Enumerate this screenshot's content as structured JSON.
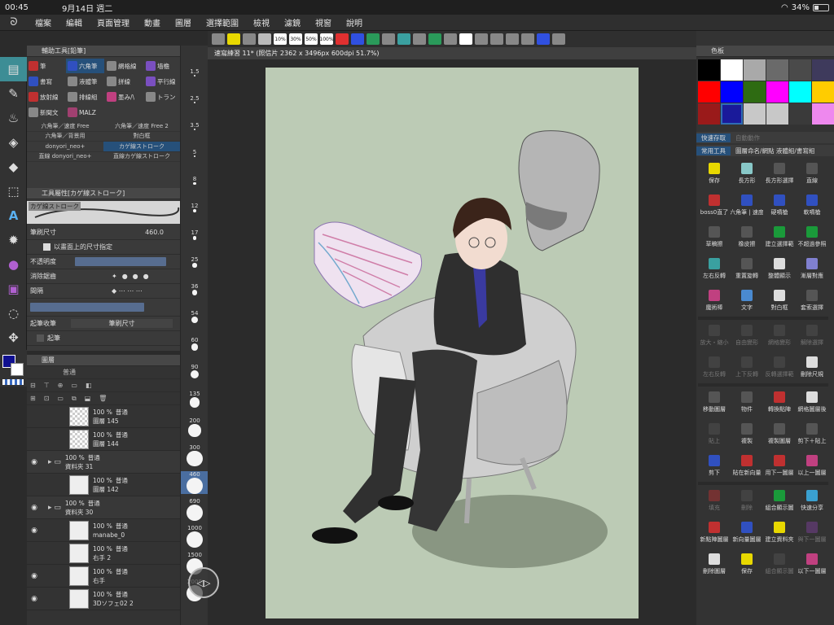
{
  "status": {
    "time": "00:45",
    "date": "9月14日 週二",
    "battery": "34%",
    "battery_level": 0.34
  },
  "menu": [
    "檔案",
    "編輯",
    "頁面管理",
    "動畫",
    "圖層",
    "選擇範圍",
    "檢視",
    "濾鏡",
    "視窗",
    "說明"
  ],
  "left_tools": [
    "select-tool-icon",
    "pen-tool-icon",
    "brush-tool-icon",
    "eraser-tool-icon",
    "fill-tool-icon",
    "selection-tool-icon",
    "text-tool-icon",
    "effect-tool-icon",
    "object-tool-icon",
    "ruler-tool-icon",
    "lasso-tool-icon",
    "move-tool-icon",
    "bucket-tool-icon"
  ],
  "subtool": {
    "title": "輔助工具[鉛筆]",
    "items": [
      {
        "label": "筆",
        "color": "#c03030"
      },
      {
        "label": "六角筆",
        "color": "#3050c0",
        "selected": true
      },
      {
        "label": "網格線",
        "color": "#888888"
      },
      {
        "label": "墙檐",
        "color": "#7a4fc0"
      },
      {
        "label": "書寫",
        "color": "#3050c0"
      },
      {
        "label": "液體筆",
        "color": "#888888"
      },
      {
        "label": "拼線",
        "color": "#888888"
      },
      {
        "label": "平行線",
        "color": "#7a4fc0"
      },
      {
        "label": "放射線",
        "color": "#c03030"
      },
      {
        "label": "排線組",
        "color": "#888888"
      },
      {
        "label": "墨み/\\",
        "color": "#c04080"
      },
      {
        "label": "トラン",
        "color": "#888888"
      },
      {
        "label": "新聞文",
        "color": "#888888"
      },
      {
        "label": "MALZ",
        "color": "#a04070"
      }
    ],
    "brushes": [
      {
        "label": "六角筆／速度 Free"
      },
      {
        "label": "六角筆／速度 Free 2"
      },
      {
        "label": "六角筆／背景用"
      },
      {
        "label": "對白框"
      },
      {
        "label": "donyori_neo+"
      },
      {
        "label": "カゲ線ストローク",
        "selected": true
      },
      {
        "label": "直線 donyori_neo+"
      },
      {
        "label": "直線カゲ線ストローク"
      }
    ]
  },
  "toolprop": {
    "title": "工具屬性[カゲ線ストローク]",
    "preview_label": "カゲ線ストローク",
    "size_label": "筆刷尺寸",
    "size_value": "460.0",
    "screen_size_label": "以畫面上的尺寸指定",
    "opacity_label": "不透明度",
    "antialias_label": "消除鋸齒",
    "spacing_label": "間隔",
    "start_end_label": "起筆收筆",
    "start_end_value": "筆刷尺寸",
    "start_label": "起筆"
  },
  "sizes": [
    "1.5",
    "2.5",
    "3.5",
    "5",
    "8",
    "12",
    "17",
    "25",
    "36",
    "54",
    "60",
    "90",
    "135",
    "200",
    "300",
    "460",
    "690",
    "1000",
    "1500",
    "2000"
  ],
  "selected_size": "460",
  "layers": {
    "title": "圖層",
    "blend": "普通",
    "rows": [
      {
        "pct": "100 %",
        "mode": "普通",
        "name": "圖層 145",
        "eye": false,
        "thumb": "checker"
      },
      {
        "pct": "100 %",
        "mode": "普通",
        "name": "圖層 144",
        "eye": false,
        "thumb": "checker"
      },
      {
        "pct": "100 %",
        "mode": "普通",
        "name": "資料夾 31",
        "eye": true,
        "folder": true
      },
      {
        "pct": "100 %",
        "mode": "普通",
        "name": "圖層 142",
        "eye": false,
        "thumb": "white"
      },
      {
        "pct": "100 %",
        "mode": "普通",
        "name": "資料夾 30",
        "eye": true,
        "folder": true
      },
      {
        "pct": "100 %",
        "mode": "普通",
        "name": "manabe_0",
        "eye": true,
        "thumb": "white"
      },
      {
        "pct": "100 %",
        "mode": "普通",
        "name": "右手 2",
        "eye": false,
        "thumb": "white"
      },
      {
        "pct": "100 %",
        "mode": "普通",
        "name": "右手",
        "eye": true,
        "thumb": "white"
      },
      {
        "pct": "100 %",
        "mode": "普通",
        "name": "3Dソフェ02 2",
        "eye": true,
        "thumb": "white"
      }
    ]
  },
  "topbar_icons": [
    "gear-icon",
    "layer-icon",
    "mask-icon",
    "save-icon",
    "10%",
    "30%",
    "50%",
    "100%",
    "color-icon",
    "ruler-icon",
    "transform-icon",
    "grid-icon",
    "flip-icon",
    "rotate-icon",
    "perspective-icon",
    "fill-icon",
    "white-icon",
    "gray-icon",
    "tone-icon",
    "screenshot-icon",
    "camera-icon",
    "zoom-icon",
    "reset-icon"
  ],
  "doc_tab": "速寫練習 11* (照信片 2362 x 3496px 600dpi 51.7%)",
  "color_set": {
    "title": "色板",
    "swatches": [
      "#000000",
      "#ffffff",
      "#a9a9a9",
      "#6a6a6a",
      "#4a4a4a",
      "#3e3a5c",
      "#ff0000",
      "#0000ff",
      "#2e6b12",
      "#ff00ff",
      "#00ffff",
      "#ffcc00",
      "#9a1a1a",
      "#1a1a9a",
      "#c8c8c8",
      "#c8c8c8",
      "#3a3a3a",
      "#ee88ee"
    ],
    "selected_index": 13
  },
  "quick": {
    "tab1": "快速存取",
    "tab2": "自動動作",
    "sub1": "常用工具",
    "sub2": "圖層命名/網點 液體組/書寫組",
    "items": [
      {
        "label": "保存",
        "color": "#e8d800",
        "icon": "save-icon"
      },
      {
        "label": "長方形",
        "color": "#88c8c8",
        "icon": "rect-icon"
      },
      {
        "label": "長方形選擇",
        "color": "#555555",
        "icon": "rect-select-icon"
      },
      {
        "label": "直線",
        "color": "#555555",
        "icon": "line-icon"
      },
      {
        "label": "boss0直了",
        "color": "#c03030",
        "icon": "pen-icon"
      },
      {
        "label": "六角筆 | 速度",
        "color": "#3050c0",
        "icon": "pen-icon"
      },
      {
        "label": "硬噴槍",
        "color": "#3050c0",
        "icon": "airbrush-icon"
      },
      {
        "label": "軟噴槍",
        "color": "#3050c0",
        "icon": "airbrush-icon"
      },
      {
        "label": "草稿擦",
        "color": "#555555",
        "icon": "eraser-icon"
      },
      {
        "label": "橡皮擦",
        "color": "#555555",
        "icon": "eraser-icon"
      },
      {
        "label": "建立選擇範",
        "color": "#1a9a3a",
        "icon": "selection-icon"
      },
      {
        "label": "不超過參照",
        "color": "#1a9a3a",
        "icon": "reference-icon"
      },
      {
        "label": "左右反轉",
        "color": "#3aa0a0",
        "icon": "flip-icon"
      },
      {
        "label": "重置旋轉",
        "color": "#555555",
        "icon": "rotate-icon"
      },
      {
        "label": "整體顯示",
        "color": "#dddddd",
        "icon": "fit-icon"
      },
      {
        "label": "漸層對應",
        "color": "#8080d0",
        "icon": "gradient-icon"
      },
      {
        "label": "魔術棒",
        "color": "#c04080",
        "icon": "wand-icon"
      },
      {
        "label": "文字",
        "color": "#4a8ad0",
        "icon": "text-icon"
      },
      {
        "label": "對白框",
        "color": "#dddddd",
        "icon": "balloon-icon"
      },
      {
        "label": "套索選擇",
        "color": "#555555",
        "icon": "lasso-icon"
      },
      {
        "label": "放大・縮小",
        "color": "#555555",
        "icon": "scale-icon",
        "dim": true
      },
      {
        "label": "自由變形",
        "color": "#555555",
        "icon": "free-transform-icon",
        "dim": true
      },
      {
        "label": "網格變形",
        "color": "#555555",
        "icon": "mesh-icon",
        "dim": true
      },
      {
        "label": "解除選擇",
        "color": "#555555",
        "icon": "deselect-icon",
        "dim": true
      },
      {
        "label": "左右反轉",
        "color": "#555555",
        "icon": "flip-icon",
        "dim": true
      },
      {
        "label": "上下反轉",
        "color": "#555555",
        "icon": "flip-v-icon",
        "dim": true
      },
      {
        "label": "反轉選擇範",
        "color": "#555555",
        "icon": "invert-icon",
        "dim": true
      },
      {
        "label": "刪除尺規",
        "color": "#dddddd",
        "icon": "delete-ruler-icon"
      },
      {
        "label": "移動圖層",
        "color": "#555555",
        "icon": "move-icon"
      },
      {
        "label": "物件",
        "color": "#555555",
        "icon": "object-icon"
      },
      {
        "label": "轉換點陣",
        "color": "#c03030",
        "icon": "raster-icon"
      },
      {
        "label": "網格圖層後",
        "color": "#dddddd",
        "icon": "grid-icon"
      },
      {
        "label": "貼上",
        "color": "#555555",
        "icon": "paste-icon",
        "dim": true
      },
      {
        "label": "複製",
        "color": "#555555",
        "icon": "copy-icon"
      },
      {
        "label": "複製圖層",
        "color": "#555555",
        "icon": "duplicate-icon"
      },
      {
        "label": "剪下＋貼上",
        "color": "#555555",
        "icon": "cut-paste-icon"
      },
      {
        "label": "剪下",
        "color": "#3050c0",
        "icon": "scissors-icon"
      },
      {
        "label": "貼在新向量",
        "color": "#c03030",
        "icon": "paste-vector-icon"
      },
      {
        "label": "用下一圖層",
        "color": "#c03030",
        "icon": "merge-icon"
      },
      {
        "label": "以上一圖層",
        "color": "#c04080",
        "icon": "up-icon"
      },
      {
        "label": "填充",
        "color": "#c03030",
        "icon": "fill-icon",
        "dim": true
      },
      {
        "label": "刪除",
        "color": "#555555",
        "icon": "delete-icon",
        "dim": true
      },
      {
        "label": "組合顯示圖",
        "color": "#1a9a3a",
        "icon": "combine-icon"
      },
      {
        "label": "快速分享",
        "color": "#3aa0d0",
        "icon": "share-icon"
      },
      {
        "label": "新點陣圖層",
        "color": "#c03030",
        "icon": "new-raster-icon"
      },
      {
        "label": "新向量圖層",
        "color": "#3050c0",
        "icon": "new-vector-icon"
      },
      {
        "label": "建立資料夾",
        "color": "#e8d800",
        "icon": "folder-icon"
      },
      {
        "label": "與下一圖層",
        "color": "#8040a0",
        "icon": "merge-down-icon",
        "dim": true
      },
      {
        "label": "刪除圖層",
        "color": "#dddddd",
        "icon": "trash-icon"
      },
      {
        "label": "保存",
        "color": "#e8d800",
        "icon": "save-icon"
      },
      {
        "label": "組合顯示圖",
        "color": "#555555",
        "icon": "combine-icon",
        "dim": true
      },
      {
        "label": "以下一圖層",
        "color": "#c04080",
        "icon": "down-icon"
      }
    ]
  }
}
